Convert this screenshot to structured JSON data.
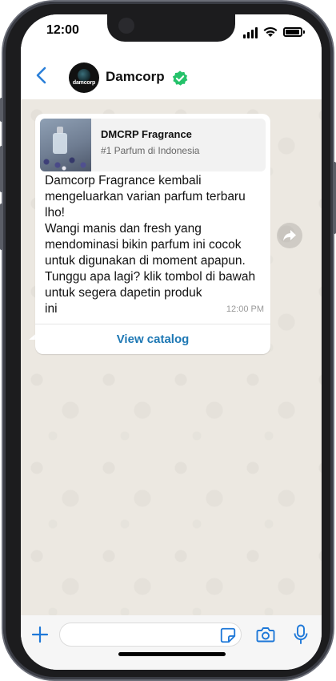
{
  "status_bar": {
    "time": "12:00"
  },
  "header": {
    "title": "Damcorp",
    "avatar_text": "damcorp",
    "accent": "#2b7fd8",
    "verified_color": "#25c26a"
  },
  "message": {
    "product_title": "DMCRP Fragrance",
    "product_subtitle": "#1 Parfum di Indonesia",
    "body": "Damcorp Fragrance kembali mengeluarkan varian parfum terbaru lho!\nWangi manis dan fresh yang mendominasi bikin parfum ini cocok untuk digunakan di moment apapun.\nTunggu apa lagi? klik tombol di bawah untuk segera dapetin produk\nini",
    "time": "12:00 PM",
    "action_label": "View catalog"
  },
  "icons": {
    "back": "chevron-left-icon",
    "verified": "verified-badge-icon",
    "forward": "forward-icon",
    "attach": "plus-icon",
    "sticker": "sticker-icon",
    "camera": "camera-icon",
    "mic": "microphone-icon"
  },
  "colors": {
    "chat_background": "#ece8e1",
    "link": "#1e78b4",
    "icon_blue": "#1e78d8"
  }
}
